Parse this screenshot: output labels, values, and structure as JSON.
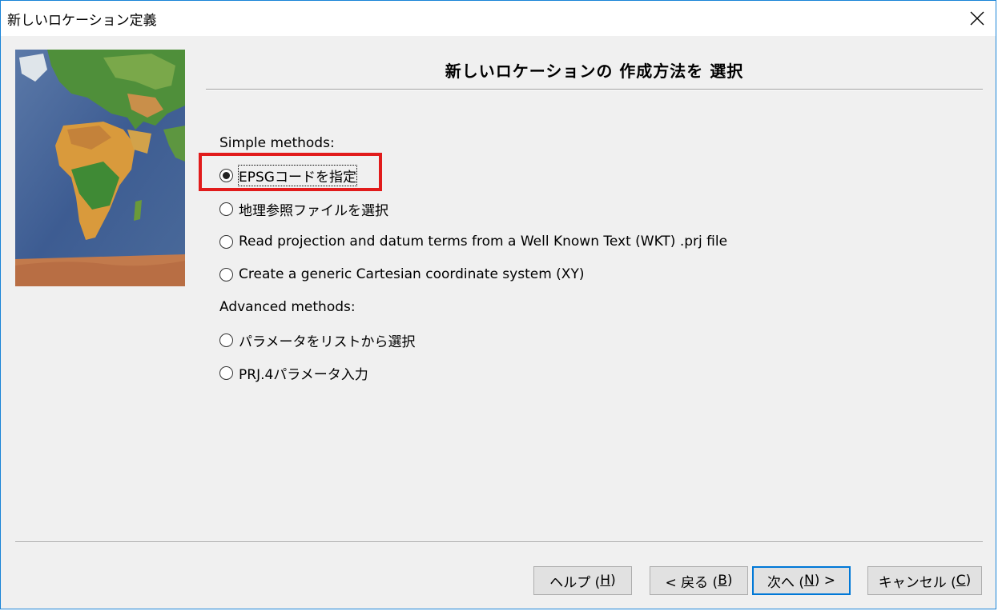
{
  "window": {
    "title": "新しいロケーション定義",
    "close_icon": "close-icon"
  },
  "page": {
    "heading": "新しいロケーションの 作成方法を 選択"
  },
  "simple": {
    "label": "Simple methods:",
    "options": [
      {
        "label": "EPSGコードを指定",
        "selected": true
      },
      {
        "label": "地理参照ファイルを選択",
        "selected": false
      },
      {
        "label": "Read projection and datum terms from a Well Known Text (WKT) .prj file",
        "selected": false
      },
      {
        "label": "Create a generic Cartesian coordinate system (XY)",
        "selected": false
      }
    ]
  },
  "advanced": {
    "label": "Advanced methods:",
    "options": [
      {
        "label": "パラメータをリストから選択",
        "selected": false
      },
      {
        "label": "PRJ.4パラメータ入力",
        "selected": false
      }
    ]
  },
  "buttons": {
    "help": {
      "pre": "ヘルプ (",
      "key": "H",
      "post": ")"
    },
    "back": {
      "pre": "< 戻る (",
      "key": "B",
      "post": ")"
    },
    "next": {
      "pre": "次へ (",
      "key": "N",
      "post": ") >"
    },
    "cancel": {
      "pre": "キャンセル (",
      "key": "C",
      "post": ")"
    }
  },
  "colors": {
    "accent": "#0078d7",
    "highlight": "#e11b1b",
    "window_border": "#1883d7"
  }
}
